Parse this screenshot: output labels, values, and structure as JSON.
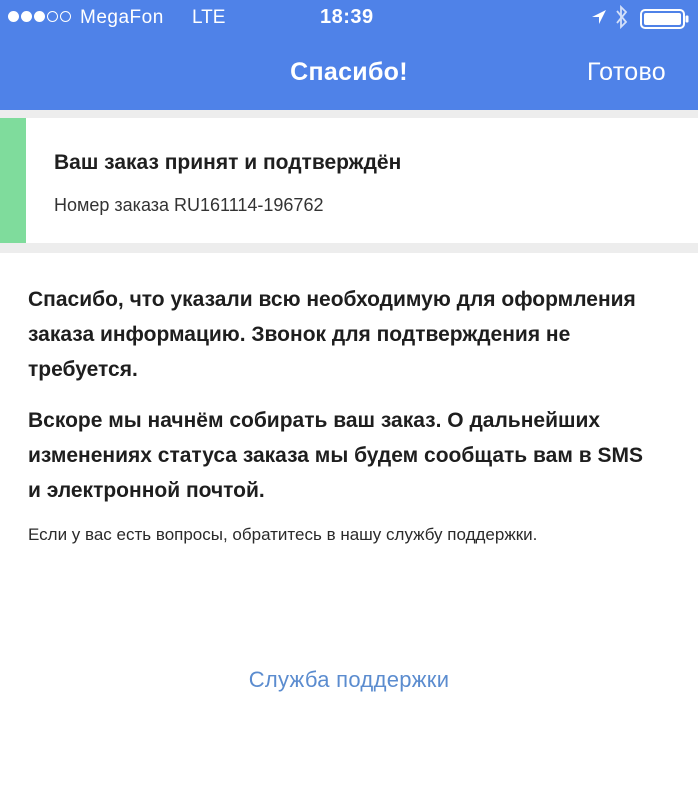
{
  "status_bar": {
    "carrier": "MegaFon",
    "network": "LTE",
    "time": "18:39",
    "signal_bars_filled": 3,
    "signal_bars_total": 5,
    "icons": [
      "location-arrow-icon",
      "bluetooth-icon",
      "battery-icon"
    ]
  },
  "nav": {
    "title": "Спасибо!",
    "done_label": "Готово"
  },
  "order_card": {
    "title": "Ваш заказ принят и подтверждён",
    "order_number_text": "Номер заказа RU161114-196762",
    "accent_color": "#7fdc9c"
  },
  "body": {
    "paragraph1": "Спасибо, что указали всю необходимую для оформления заказа информацию. Звонок для подтверждения не требуется.",
    "paragraph2": "Вскоре мы начнём собирать ваш заказ. О дальнейших изменениях статуса заказа мы будем сообщать вам в SMS и электронной почтой.",
    "note": "Если у вас есть вопросы, обратитесь в нашу службу поддержки."
  },
  "support_link_label": "Служба поддержки",
  "colors": {
    "header_blue": "#4f82e8",
    "link_blue": "#5b8ccf",
    "separator_gray": "#ededed"
  }
}
